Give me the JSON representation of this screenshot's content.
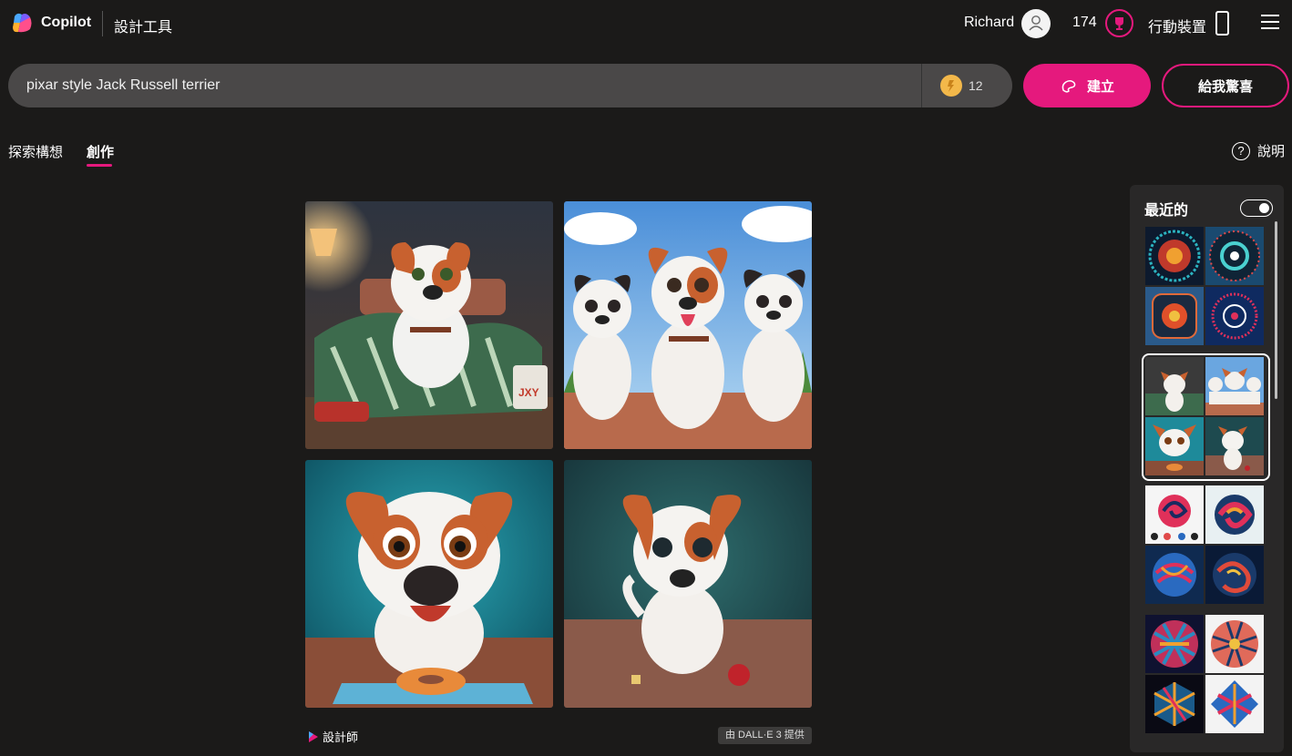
{
  "header": {
    "brand": "Copilot",
    "tool_name": "設計工具",
    "user_name": "Richard",
    "points": "174",
    "mobile_label": "行動裝置"
  },
  "prompt": {
    "value": "pixar style Jack Russell terrier",
    "boost_count": "12",
    "create_label": "建立",
    "surprise_label": "給我驚喜"
  },
  "tabs": [
    {
      "label": "探索構想",
      "active": false
    },
    {
      "label": "創作",
      "active": true
    }
  ],
  "help_label": "說明",
  "results": {
    "designer_label": "設計師",
    "provider_label": "由 DALL·E 3 提供",
    "images": [
      "jack-russell-bedroom",
      "three-jack-russells-sky",
      "jack-russell-donut-teal",
      "jack-russell-red-ball"
    ]
  },
  "recent": {
    "title": "最近的",
    "toggle_on": true,
    "groups": [
      "mandala-set",
      "jack-russell-set",
      "swirl-set",
      "woven-geometric-set"
    ]
  },
  "colors": {
    "accent": "#e5197d",
    "background": "#1b1a19",
    "search_bg": "#4a4848",
    "panel_bg": "#292828"
  }
}
